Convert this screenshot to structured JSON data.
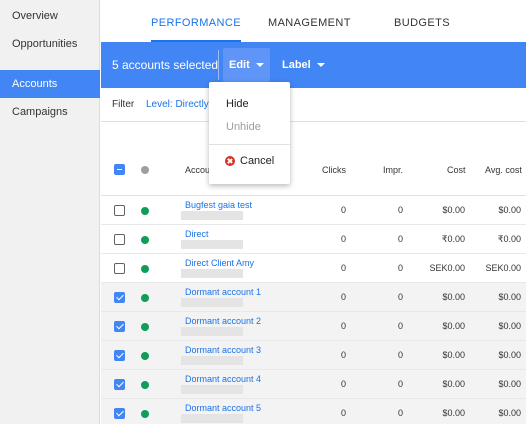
{
  "sidebar": {
    "items": [
      {
        "label": "Overview",
        "active": false
      },
      {
        "label": "Opportunities",
        "active": false
      },
      {
        "label": "Accounts",
        "active": true
      },
      {
        "label": "Campaigns",
        "active": false
      }
    ]
  },
  "tabs": [
    {
      "label": "PERFORMANCE",
      "active": true
    },
    {
      "label": "MANAGEMENT",
      "active": false
    },
    {
      "label": "BUDGETS",
      "active": false
    }
  ],
  "selection_bar": {
    "count_text": "5 accounts selected",
    "edit_label": "Edit",
    "label_label": "Label"
  },
  "filter": {
    "label": "Filter",
    "value": "Level: Directly li"
  },
  "edit_menu": {
    "hide": "Hide",
    "unhide": "Unhide",
    "cancel": "Cancel"
  },
  "table": {
    "columns": {
      "account": "Accou",
      "clicks": "Clicks",
      "impr": "Impr.",
      "cost": "Cost",
      "avg_cost": "Avg. cost"
    },
    "rows": [
      {
        "name": "Bugfest gaia test",
        "checked": false,
        "clicks": "0",
        "impr": "0",
        "cost": "$0.00",
        "avg_cost": "$0.00"
      },
      {
        "name": "Direct",
        "checked": false,
        "clicks": "0",
        "impr": "0",
        "cost": "₹0.00",
        "avg_cost": "₹0.00"
      },
      {
        "name": "Direct Client Amy",
        "checked": false,
        "clicks": "0",
        "impr": "0",
        "cost": "SEK0.00",
        "avg_cost": "SEK0.00"
      },
      {
        "name": "Dormant account 1",
        "checked": true,
        "clicks": "0",
        "impr": "0",
        "cost": "$0.00",
        "avg_cost": "$0.00"
      },
      {
        "name": "Dormant account 2",
        "checked": true,
        "clicks": "0",
        "impr": "0",
        "cost": "$0.00",
        "avg_cost": "$0.00"
      },
      {
        "name": "Dormant account 3",
        "checked": true,
        "clicks": "0",
        "impr": "0",
        "cost": "$0.00",
        "avg_cost": "$0.00"
      },
      {
        "name": "Dormant account 4",
        "checked": true,
        "clicks": "0",
        "impr": "0",
        "cost": "$0.00",
        "avg_cost": "$0.00"
      },
      {
        "name": "Dormant account 5",
        "checked": true,
        "clicks": "0",
        "impr": "0",
        "cost": "$0.00",
        "avg_cost": "$0.00"
      }
    ]
  },
  "colors": {
    "accent": "#4285f4",
    "link": "#1a73e8",
    "status_enabled": "#0f9d58",
    "cancel_icon": "#d93025"
  }
}
